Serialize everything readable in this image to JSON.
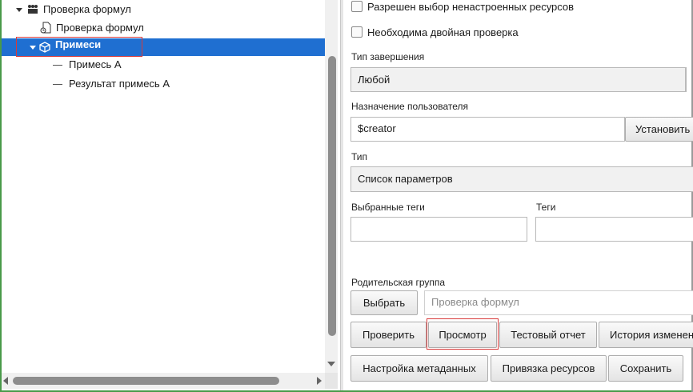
{
  "tree": {
    "items": [
      {
        "label": "Проверка формул",
        "icon": "group-icon"
      },
      {
        "label": "Проверка формул",
        "icon": "formula-file-icon"
      },
      {
        "label": "Примеси",
        "icon": "cube-icon",
        "selected": true
      },
      {
        "label": "Примесь А",
        "icon": "dash-icon"
      },
      {
        "label": "Результат примесь А",
        "icon": "dash-icon"
      }
    ]
  },
  "form": {
    "checkbox_unconfigured_resources": "Разрешен выбор ненастроенных ресурсов",
    "checkbox_double_check": "Необходима двойная проверка",
    "completion_type_label": "Тип завершения",
    "completion_type_value": "Любой",
    "user_assignment_label": "Назначение пользователя",
    "user_assignment_value": "$creator",
    "set_button": "Установить",
    "type_label": "Тип",
    "type_value": "Список параметров",
    "selected_tags_label": "Выбранные теги",
    "tags_label": "Теги",
    "parent_group_label": "Родительская группа",
    "select_button": "Выбрать",
    "parent_group_placeholder": "Проверка формул"
  },
  "actions": {
    "check": "Проверить",
    "preview": "Просмотр",
    "test_report": "Тестовый отчет",
    "change_history": "История изменений",
    "metadata_settings": "Настройка метаданных",
    "resource_binding": "Привязка ресурсов",
    "save": "Сохранить"
  },
  "colors": {
    "selection": "#1f6fd1",
    "highlight_outline": "#d83a3a",
    "frame": "#4a9a4a"
  }
}
